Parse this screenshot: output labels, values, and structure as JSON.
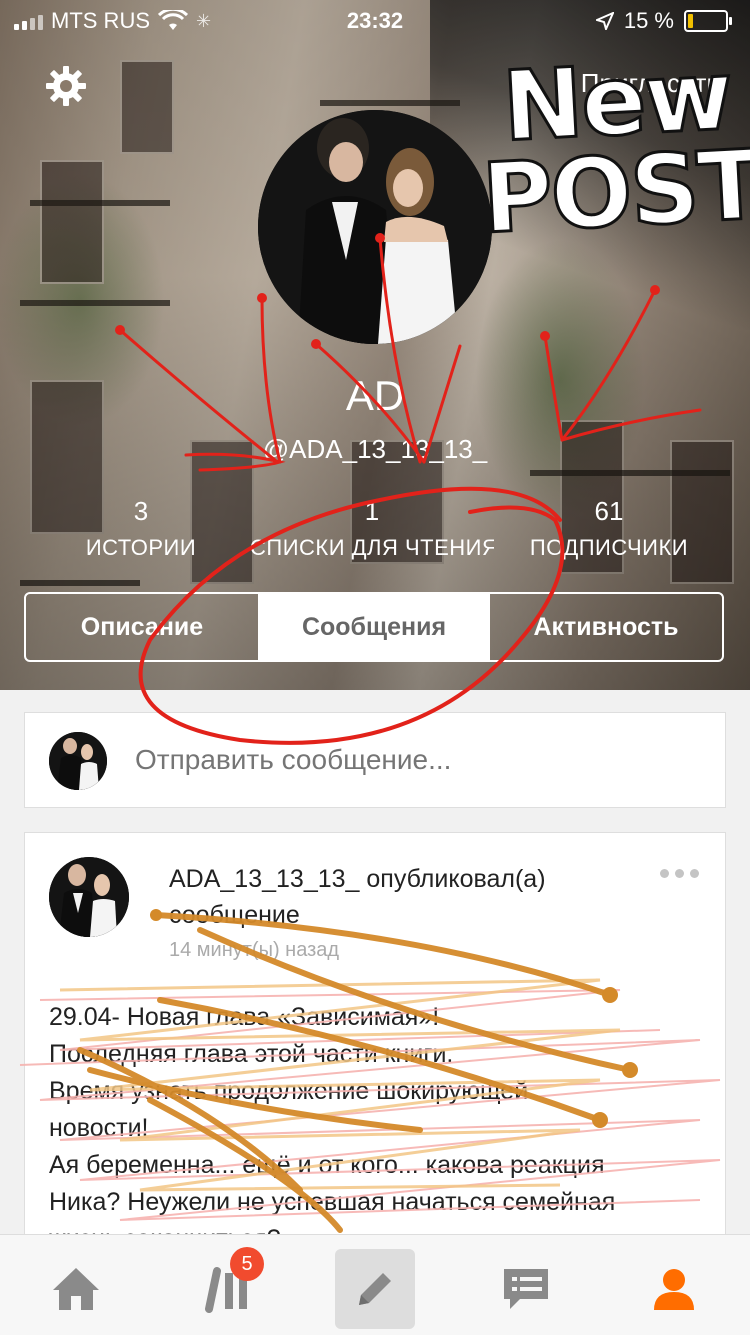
{
  "status_bar": {
    "carrier": "MTS RUS",
    "time": "23:32",
    "battery_percent_label": "15 %",
    "battery_level": 0.15
  },
  "header": {
    "top_right_link": "Пригласить",
    "name": "AD",
    "handle": "@ADA_13_13_13_"
  },
  "stats": [
    {
      "value": "3",
      "label": "ИСТОРИИ"
    },
    {
      "value": "1",
      "label": "СПИСКИ ДЛЯ ЧТЕНИЯ"
    },
    {
      "value": "61",
      "label": "ПОДПИСЧИКИ"
    }
  ],
  "tabs": [
    {
      "label": "Описание"
    },
    {
      "label": "Сообщения",
      "active": true
    },
    {
      "label": "Активность"
    }
  ],
  "composer": {
    "placeholder": "Отправить сообщение..."
  },
  "post": {
    "header_text": "ADA_13_13_13_ опубликовал(а) сообщение",
    "time": "14 минут(ы) назад",
    "body_lines": [
      "29.04- Новая глава «Зависимая»!",
      "Последняя глава этой части книги.",
      "Время узнать продолжение шокирующей",
      "новости!",
      "Ая беременна... ещё и от кого... какова реакция",
      "Ника? Неужели не успевшая начаться семейная",
      "жизнь закончиться?"
    ]
  },
  "overlay_text": {
    "line1": "New",
    "line2": "POST"
  },
  "tabbar": {
    "library_badge": "5"
  },
  "colors": {
    "accent": "#ff6d00",
    "badge": "#f14b2e",
    "annotation_red": "#e2221a",
    "annotation_orange": "#d48a2a"
  }
}
